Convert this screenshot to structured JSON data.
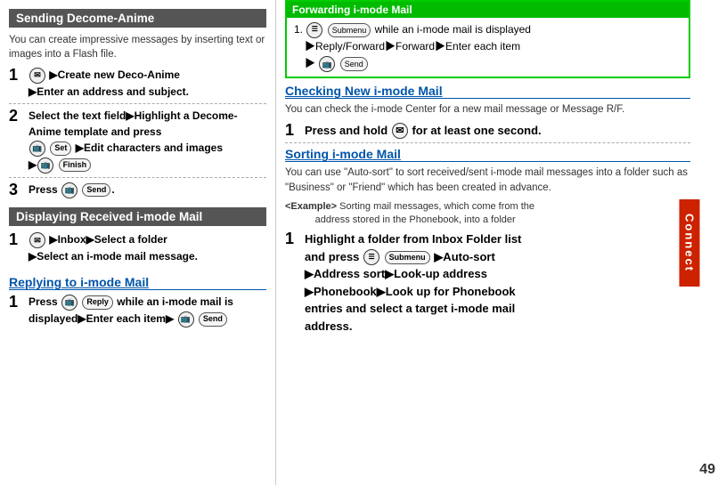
{
  "left": {
    "section1_title": "Sending Decome-Anime",
    "section1_intro": "You can create impressive messages by inserting text or images into a Flash file.",
    "step1": "▶Create new Deco-Anime\n▶Enter an address and subject.",
    "step2_part1": "Select the text field▶Highlight a Decome-Anime template and press",
    "step2_part2": "▶Edit characters and images\n▶",
    "step3": "Press",
    "step3_end": ".",
    "section2_title": "Displaying Received i-mode Mail",
    "disp_step1": "▶Inbox▶Select a folder\n▶Select an i-mode mail message.",
    "section3_title": "Replying to i-mode Mail",
    "reply_step1_start": "Press",
    "reply_step1_mid": "while an i-mode mail is\ndisplayed▶Enter each item▶",
    "reply_icon": "Reply",
    "send_icon": "Send"
  },
  "right": {
    "forwarding_title": "Forwarding i-mode Mail",
    "forwarding_step": "while an i-mode mail is displayed\n▶Reply/Forward▶Forward▶Enter each item\n▶",
    "section1_title": "Checking New i-mode Mail",
    "section1_intro": "You can check the i-mode Center for a new mail message or Message R/F.",
    "check_step": "Press and hold",
    "check_step_end": "for at least one second.",
    "section2_title": "Sorting i-mode Mail",
    "sorting_intro": "You can use \"Auto-sort\" to sort received/sent i-mode mail messages into a folder such as \"Business\" or \"Friend\" which has been created in advance.",
    "example_label": "<Example>",
    "example_text": "Sorting mail messages, which come from the\naddress stored in the Phonebook, into a folder",
    "sort_step": "Highlight a folder from Inbox Folder list\nand press",
    "sort_step_mid": "▶Auto-sort\n▶Address sort▶Look-up address\n▶Phonebook▶Look up for Phonebook\nentries and select a target i-mode mail\naddress.",
    "page_num": "49",
    "connect_label": "Connect"
  }
}
